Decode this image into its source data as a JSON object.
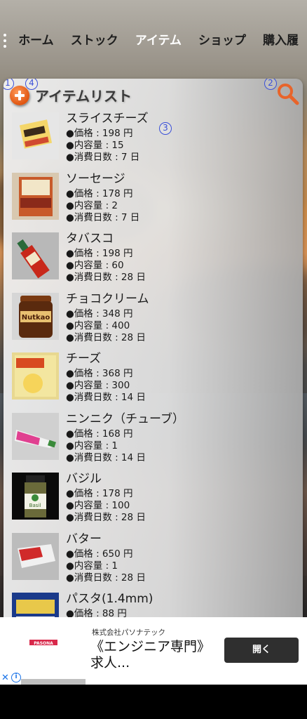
{
  "nav": {
    "tabs": [
      {
        "label": "ホーム",
        "active": false
      },
      {
        "label": "ストック",
        "active": false
      },
      {
        "label": "アイテム",
        "active": true
      },
      {
        "label": "ショップ",
        "active": false
      },
      {
        "label": "購入履"
      }
    ]
  },
  "panel": {
    "title": "アイテムリスト",
    "badges": [
      "1",
      "4",
      "2",
      "3"
    ]
  },
  "items": [
    {
      "name": "スライスチーズ",
      "price": "●価格 : 198 円",
      "content": "●内容量 : 15",
      "days": "●消費日数 : 7 日"
    },
    {
      "name": "ソーセージ",
      "price": "●価格 : 178 円",
      "content": "●内容量 : 2",
      "days": "●消費日数 : 7 日"
    },
    {
      "name": "タバスコ",
      "price": "●価格 : 198 円",
      "content": "●内容量 : 60",
      "days": "●消費日数 : 28 日"
    },
    {
      "name": "チョコクリーム",
      "price": "●価格 : 348 円",
      "content": "●内容量 : 400",
      "days": "●消費日数 : 28 日"
    },
    {
      "name": "チーズ",
      "price": "●価格 : 368 円",
      "content": "●内容量 : 300",
      "days": "●消費日数 : 14 日"
    },
    {
      "name": "ニンニク（チューブ）",
      "price": "●価格 : 168 円",
      "content": "●内容量 : 1",
      "days": "●消費日数 : 14 日"
    },
    {
      "name": "バジル",
      "price": "●価格 : 178 円",
      "content": "●内容量 : 100",
      "days": "●消費日数 : 28 日"
    },
    {
      "name": "バター",
      "price": "●価格 : 650 円",
      "content": "●内容量 : 1",
      "days": "●消費日数 : 28 日"
    },
    {
      "name": "パスタ(1.4mm)",
      "price": "●価格 : 88 円",
      "content": "",
      "days": ""
    }
  ],
  "thumb_text": {
    "nutkao": "Nutkao",
    "basil": "Basil"
  },
  "ad": {
    "company": "株式会社パソナテック",
    "headline": "《エンジニア専門》求人...",
    "button": "開く",
    "logo_text": "PASONA",
    "close": "✕",
    "info": "i"
  },
  "icons": {
    "menu": "more-vert-icon",
    "add": "add-circle-icon",
    "search": "search-icon"
  },
  "colors": {
    "accent": "#e86a2a",
    "badge": "#3a4fd8"
  }
}
